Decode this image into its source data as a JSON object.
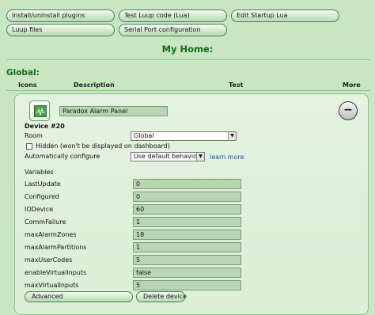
{
  "toolbar": {
    "install_plugins": "Install/uninstall plugins",
    "test_luup": "Test Luup code (Lua)",
    "edit_startup": "Edit Startup Lua",
    "luup_files": "Luup files",
    "serial_port": "Serial Port configuration"
  },
  "page_title": "My Home:",
  "section_title": "Global:",
  "columns": {
    "icons": "Icons",
    "description": "Description",
    "test": "Test",
    "more": "More"
  },
  "device": {
    "name": "Paradox Alarm Panel",
    "number_label": "Device #20",
    "room_label": "Room",
    "room_value": "Global",
    "hidden_label": "Hidden (won't be displayed on dashboard)",
    "hidden_checked": false,
    "auto_config_label": "Automatically configure",
    "auto_config_value": "Use default behavior",
    "learn_more": "learn more",
    "more_button": "−"
  },
  "variables": {
    "title": "Variables",
    "items": [
      {
        "name": "LastUpdate",
        "value": "0"
      },
      {
        "name": "Configured",
        "value": "0"
      },
      {
        "name": "IODevice",
        "value": "60"
      },
      {
        "name": "CommFailure",
        "value": "1"
      },
      {
        "name": "maxAlarmZones",
        "value": "18"
      },
      {
        "name": "maxAlarmPartitions",
        "value": "1"
      },
      {
        "name": "maxUserCodes",
        "value": "5"
      },
      {
        "name": "enableVirtualInputs",
        "value": "false"
      },
      {
        "name": "maxVirtualInputs",
        "value": "5"
      }
    ]
  },
  "footer": {
    "advanced": "Advanced",
    "delete_device": "Delete device"
  }
}
